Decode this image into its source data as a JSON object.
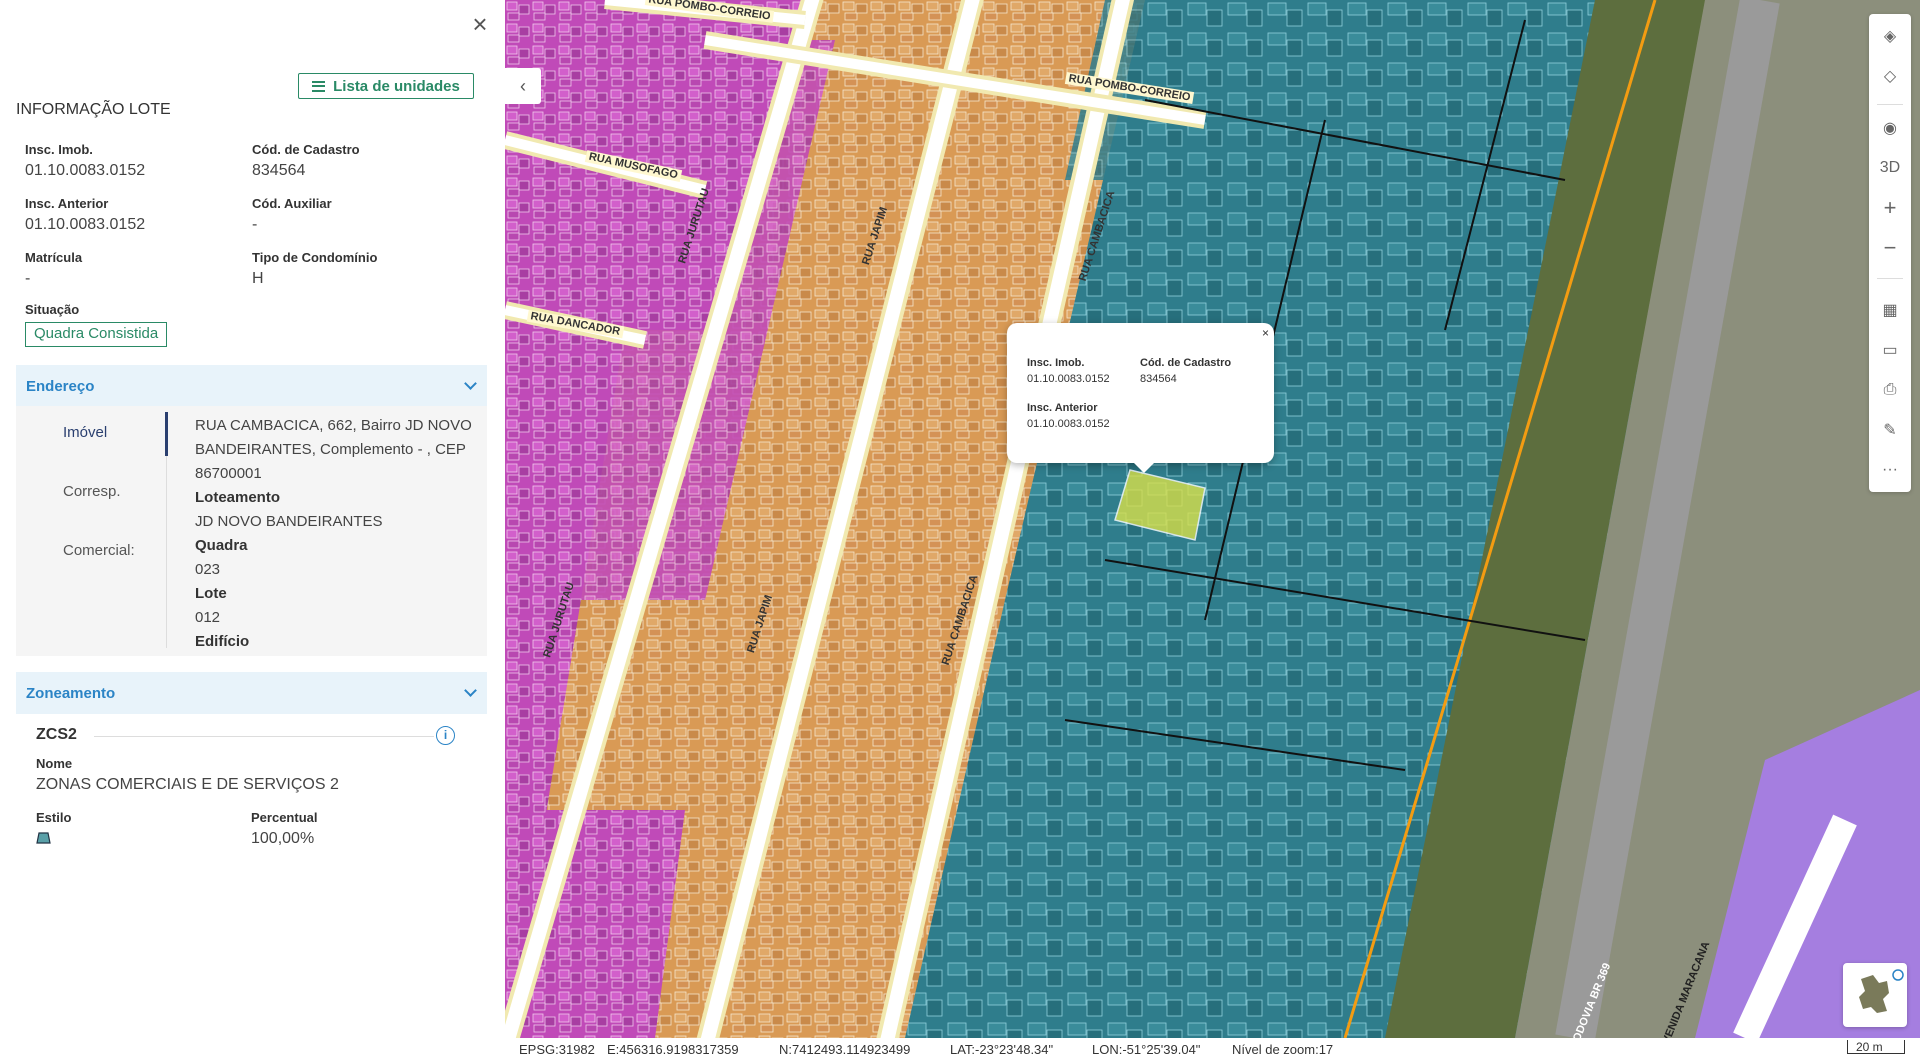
{
  "panel": {
    "close_label": "×",
    "units_button": "Lista de unidades",
    "title": "INFORMAÇÃO LOTE",
    "fields": {
      "insc_imob": {
        "label": "Insc. Imob.",
        "value": "01.10.0083.0152"
      },
      "cod_cadastro": {
        "label": "Cód. de Cadastro",
        "value": "834564"
      },
      "insc_anterior": {
        "label": "Insc. Anterior",
        "value": "01.10.0083.0152"
      },
      "cod_auxiliar": {
        "label": "Cód. Auxiliar",
        "value": "-"
      },
      "matricula": {
        "label": "Matrícula",
        "value": "-"
      },
      "tipo_condominio": {
        "label": "Tipo de Condomínio",
        "value": "H"
      },
      "situacao": {
        "label": "Situação",
        "value": "Quadra Consistida"
      }
    },
    "endereco": {
      "header": "Endereço",
      "tabs": [
        "Imóvel",
        "Corresp.",
        "Comercial:"
      ],
      "address_line": "RUA CAMBACICA, 662, Bairro JD NOVO BANDEIRANTES, Complemento - , CEP 86700001",
      "loteamento_label": "Loteamento",
      "loteamento_value": "JD NOVO BANDEIRANTES",
      "quadra_label": "Quadra",
      "quadra_value": "023",
      "lote_label": "Lote",
      "lote_value": "012",
      "edificio_label": "Edifício"
    },
    "zoneamento": {
      "header": "Zoneamento",
      "code": "ZCS2",
      "info_icon": "info-icon",
      "nome_label": "Nome",
      "nome_value": "ZONAS COMERCIAIS E DE SERVIÇOS 2",
      "estilo_label": "Estilo",
      "estilo_color": "#5aa0a8",
      "percentual_label": "Percentual",
      "percentual_value": "100,00%"
    }
  },
  "map": {
    "collapse_label": "‹",
    "streets": [
      "RUA POMBO-CORREIO",
      "RUA POMBO-CORREIO",
      "RUA MUSOFAGO",
      "RUA JURUTAU",
      "RUA JAPIM",
      "RUA CAMBACICA",
      "RUA DANCADOR",
      "RUA JURUTAU",
      "RUA JAPIM",
      "RUA CAMBACICA",
      "RODOVIA BR 369",
      "AVENIDA MARACANA"
    ],
    "popup": {
      "close": "×",
      "insc_imob_label": "Insc. Imob.",
      "insc_imob_value": "01.10.0083.0152",
      "cod_cadastro_label": "Cód. de Cadastro",
      "cod_cadastro_value": "834564",
      "insc_anterior_label": "Insc. Anterior",
      "insc_anterior_value": "01.10.0083.0152"
    },
    "toolbar": [
      {
        "name": "layers-icon",
        "glyph": "◈"
      },
      {
        "name": "layers-stack-icon",
        "glyph": "◇"
      },
      {
        "name": "compass-icon",
        "glyph": "◉"
      },
      {
        "name": "3d-button",
        "glyph": "3D"
      },
      {
        "name": "zoom-in-button",
        "glyph": "+"
      },
      {
        "name": "zoom-out-button",
        "glyph": "−"
      },
      {
        "name": "map-icon",
        "glyph": "▦"
      },
      {
        "name": "ruler-icon",
        "glyph": "▭"
      },
      {
        "name": "print-icon",
        "glyph": "⎙"
      },
      {
        "name": "paint-icon",
        "glyph": "✎"
      },
      {
        "name": "more-icon",
        "glyph": "···"
      }
    ]
  },
  "statusbar": {
    "epsg": "EPSG:31982",
    "easting": "E:456316.9198317359",
    "northing": "N:7412493.114923499",
    "lat": "LAT:-23°23'48.34\"",
    "lon": "LON:-51°25'39.04\"",
    "zoom": "Nível de zoom:17",
    "scale": "20 m"
  },
  "colors": {
    "accent_green": "#2a8a66",
    "accent_blue": "#2b84c6",
    "section_bg": "#e8f3fa",
    "residential": "#d99a55",
    "commercial": "#c04ab8",
    "industrial": "#2f7d8c",
    "selected_lot": "#d8e04a"
  }
}
